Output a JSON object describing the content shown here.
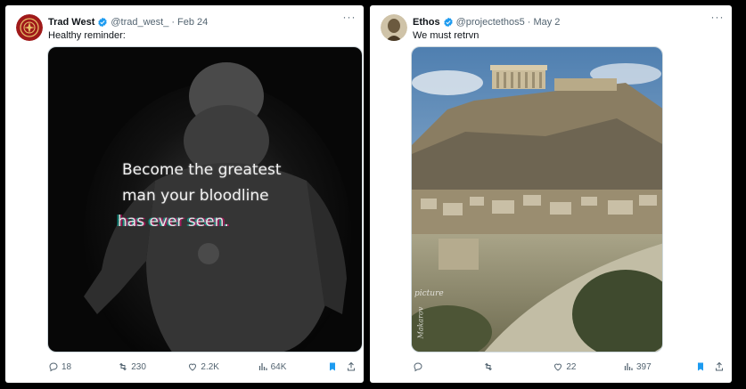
{
  "tweets": [
    {
      "name": "Trad West",
      "handle": "@trad_west_",
      "separator": "·",
      "date": "Feb 24",
      "text": "Healthy reminder:",
      "media": {
        "overlay_lines": [
          "Become the greatest",
          "man your bloodline",
          "has ever seen."
        ]
      },
      "actions": {
        "replies": "18",
        "reposts": "230",
        "likes": "2.2K",
        "views": "64K"
      }
    },
    {
      "name": "Ethos",
      "handle": "@projectethos5",
      "separator": "·",
      "date": "May 2",
      "text": "We must retrvn",
      "media": {
        "watermark": "picture",
        "signature": "Makarov"
      },
      "actions": {
        "replies": "",
        "reposts": "",
        "likes": "22",
        "views": "397"
      }
    }
  ],
  "colors": {
    "verified": "#1d9bf0",
    "bookmark": "#1d9bf0",
    "muted": "#536471",
    "text": "#0f1419"
  },
  "icons": [
    "verified-badge-icon",
    "more-icon",
    "reply-icon",
    "repost-icon",
    "like-icon",
    "views-icon",
    "bookmark-icon",
    "share-icon"
  ]
}
